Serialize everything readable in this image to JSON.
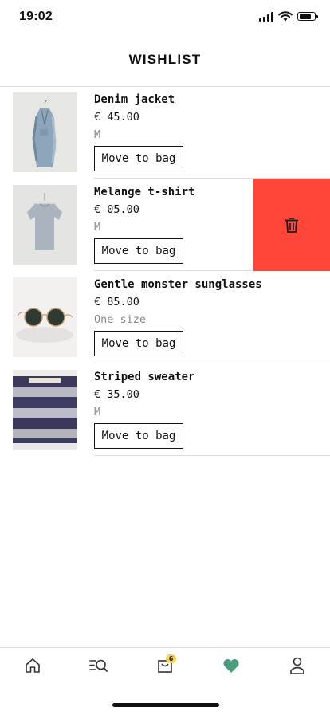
{
  "status_bar": {
    "time": "19:02"
  },
  "header": {
    "title": "WISHLIST"
  },
  "items": [
    {
      "name": "Denim jacket",
      "price": "€ 45.00",
      "size": "M",
      "button_label": "Move to bag"
    },
    {
      "name": "Melange t-shirt",
      "price": "€ 05.00",
      "size": "M",
      "button_label": "Move to bag",
      "swiped": true
    },
    {
      "name": "Gentle monster sunglasses",
      "price": "€ 85.00",
      "size": "One size",
      "button_label": "Move to bag"
    },
    {
      "name": "Striped sweater",
      "price": "€ 35.00",
      "size": "M",
      "button_label": "Move to bag"
    }
  ],
  "delete_action": {
    "icon": "trash-icon",
    "color": "#ff4638"
  },
  "tab_bar": {
    "tabs": [
      {
        "icon": "home-icon"
      },
      {
        "icon": "search-icon"
      },
      {
        "icon": "bag-icon",
        "badge": "6"
      },
      {
        "icon": "heart-icon",
        "active": true
      },
      {
        "icon": "profile-icon"
      }
    ],
    "active_color": "#4a9d7a",
    "badge_color": "#f2d34e"
  }
}
